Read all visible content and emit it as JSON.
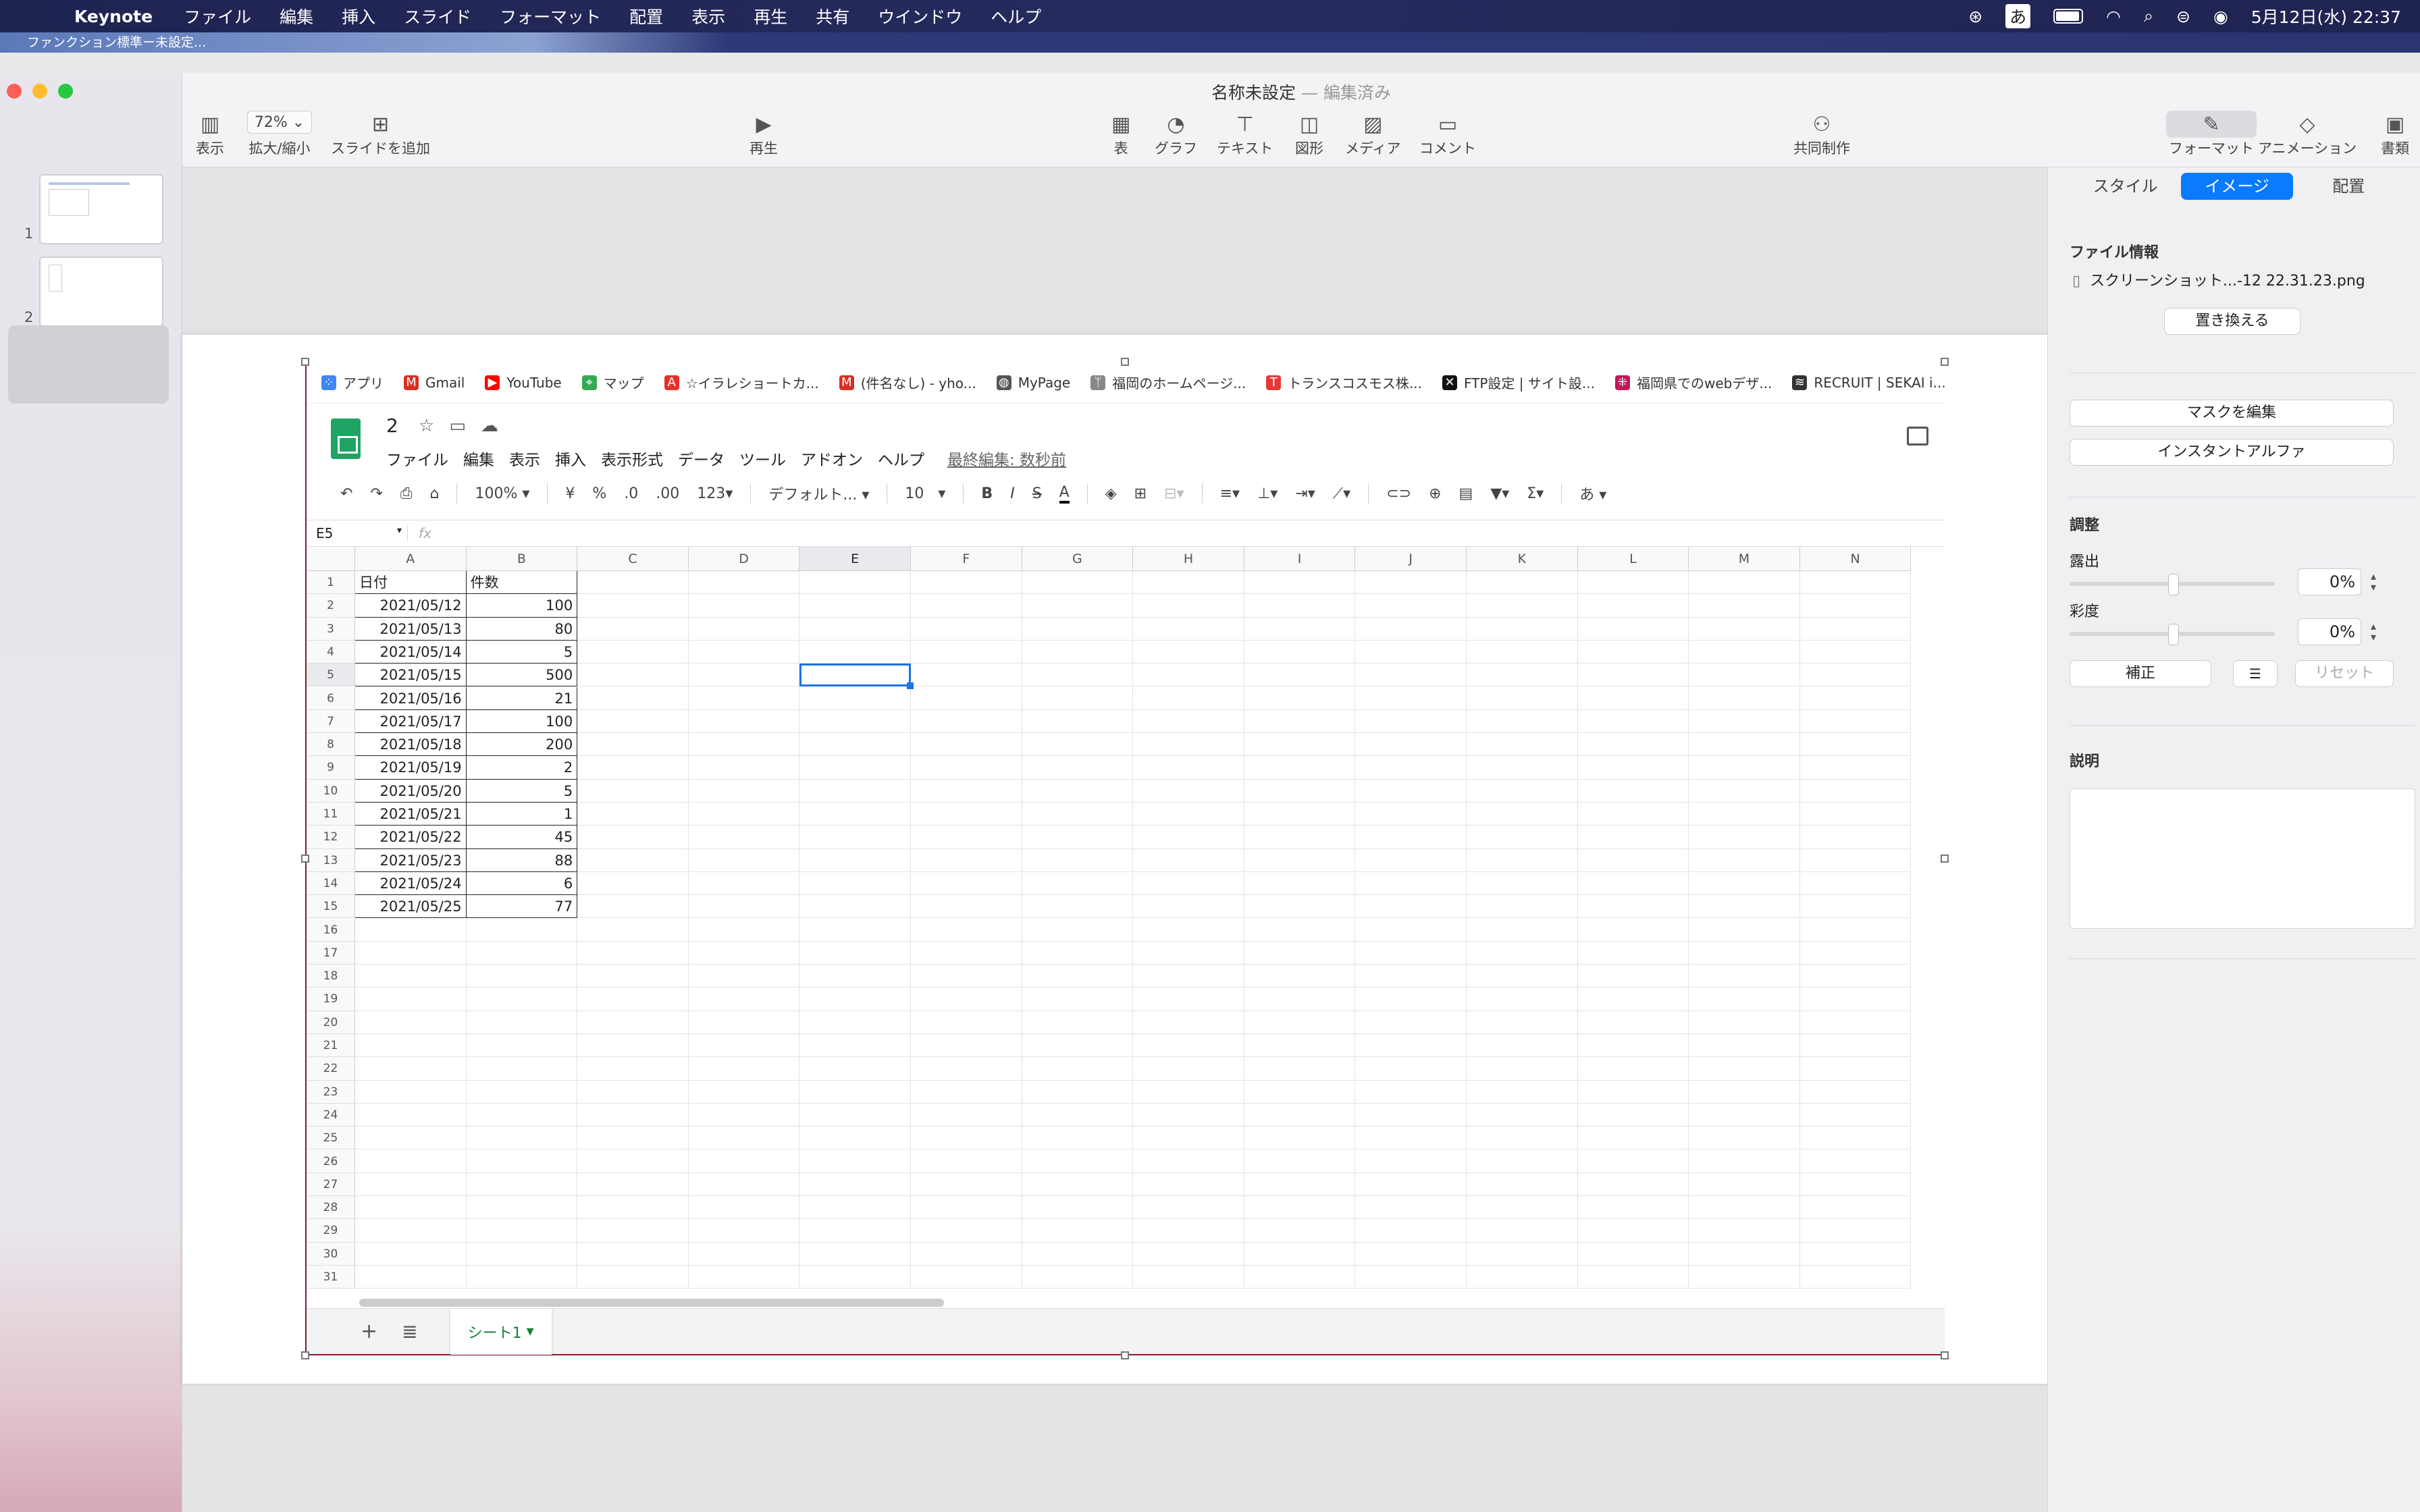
{
  "menubar": {
    "items": [
      "Keynote",
      "ファイル",
      "編集",
      "挿入",
      "スライド",
      "フォーマット",
      "配置",
      "表示",
      "再生",
      "共有",
      "ウインドウ",
      "ヘルプ"
    ],
    "input": "あ",
    "datetime": "5月12日(水)  22:37"
  },
  "stripe": {
    "text": "ファンクション標準ー未設定..."
  },
  "window": {
    "title": "名称未設定",
    "subtitle": "— 編集済み"
  },
  "toolbar": {
    "view": "表示",
    "zoom_value": "72%",
    "zoom": "拡大/縮小",
    "add_slide": "スライドを追加",
    "play": "再生",
    "table": "表",
    "chart": "グラフ",
    "text": "テキスト",
    "shape": "図形",
    "media": "メディア",
    "comment": "コメント",
    "collab": "共同制作",
    "format": "フォーマット",
    "animation": "アニメーション",
    "document": "書類"
  },
  "thumbs": [
    "1",
    "2"
  ],
  "browser": {
    "bookmarks": [
      {
        "label": "アプリ",
        "color": "#4285f4"
      },
      {
        "label": "Gmail",
        "color": "#d93025"
      },
      {
        "label": "YouTube",
        "color": "#ff0000"
      },
      {
        "label": "マップ",
        "color": "#34a853"
      },
      {
        "label": "☆イラレショートカ...",
        "color": "#e8302a"
      },
      {
        "label": "(件名なし) - yho...",
        "color": "#d93025"
      },
      {
        "label": "MyPage",
        "color": "#555555"
      },
      {
        "label": "福岡のホームページ...",
        "color": "#888888"
      },
      {
        "label": "トランスコスモス株...",
        "color": "#e53935"
      },
      {
        "label": "FTP設定 | サイト設...",
        "color": "#111111"
      },
      {
        "label": "福岡県でのwebデザ...",
        "color": "#c2185b"
      },
      {
        "label": "RECRUIT | SEKAI i...",
        "color": "#333333"
      }
    ]
  },
  "sheets": {
    "doc_title": "2",
    "menu": [
      "ファイル",
      "編集",
      "表示",
      "挿入",
      "表示形式",
      "データ",
      "ツール",
      "アドオン",
      "ヘルプ"
    ],
    "last_edit": "最終編集: 数秒前",
    "toolbar": {
      "zoom": "100%",
      "currency": "¥",
      "percent": "%",
      "dec_less": ".0",
      "dec_more": ".00",
      "format": "123",
      "font": "デフォルト...",
      "size": "10",
      "bold": "B",
      "italic": "I",
      "strike": "S",
      "textcolor": "A",
      "sum": "Σ",
      "input": "あ"
    },
    "cell_ref": "E5",
    "fx": "fx",
    "columns": [
      "A",
      "B",
      "C",
      "D",
      "E",
      "F",
      "G",
      "H",
      "I",
      "J",
      "K",
      "L",
      "M",
      "N"
    ],
    "rows": [
      "1",
      "2",
      "3",
      "4",
      "5",
      "6",
      "7",
      "8",
      "9",
      "10",
      "11",
      "12",
      "13",
      "14",
      "15",
      "16",
      "17",
      "18",
      "19",
      "20",
      "21",
      "22",
      "23",
      "24",
      "25",
      "26",
      "27",
      "28",
      "29",
      "30",
      "31"
    ],
    "table": {
      "headers": [
        "日付",
        "件数"
      ],
      "data": [
        [
          "2021/05/12",
          "100"
        ],
        [
          "2021/05/13",
          "80"
        ],
        [
          "2021/05/14",
          "5"
        ],
        [
          "2021/05/15",
          "500"
        ],
        [
          "2021/05/16",
          "21"
        ],
        [
          "2021/05/17",
          "100"
        ],
        [
          "2021/05/18",
          "200"
        ],
        [
          "2021/05/19",
          "2"
        ],
        [
          "2021/05/20",
          "5"
        ],
        [
          "2021/05/21",
          "1"
        ],
        [
          "2021/05/22",
          "45"
        ],
        [
          "2021/05/23",
          "88"
        ],
        [
          "2021/05/24",
          "6"
        ],
        [
          "2021/05/25",
          "77"
        ]
      ]
    },
    "tab": "シート1",
    "plus": "+",
    "list": "≣"
  },
  "inspector": {
    "tabs": [
      "スタイル",
      "イメージ",
      "配置"
    ],
    "file_info": "ファイル情報",
    "file_name": "スクリーンショット...-12 22.31.23.png",
    "replace": "置き換える",
    "edit_mask": "マスクを編集",
    "instant_alpha": "インスタントアルファ",
    "adjust": "調整",
    "exposure": "露出",
    "exposure_value": "0%",
    "saturation": "彩度",
    "saturation_value": "0%",
    "enhance": "補正",
    "reset": "リセット",
    "description": "説明"
  }
}
